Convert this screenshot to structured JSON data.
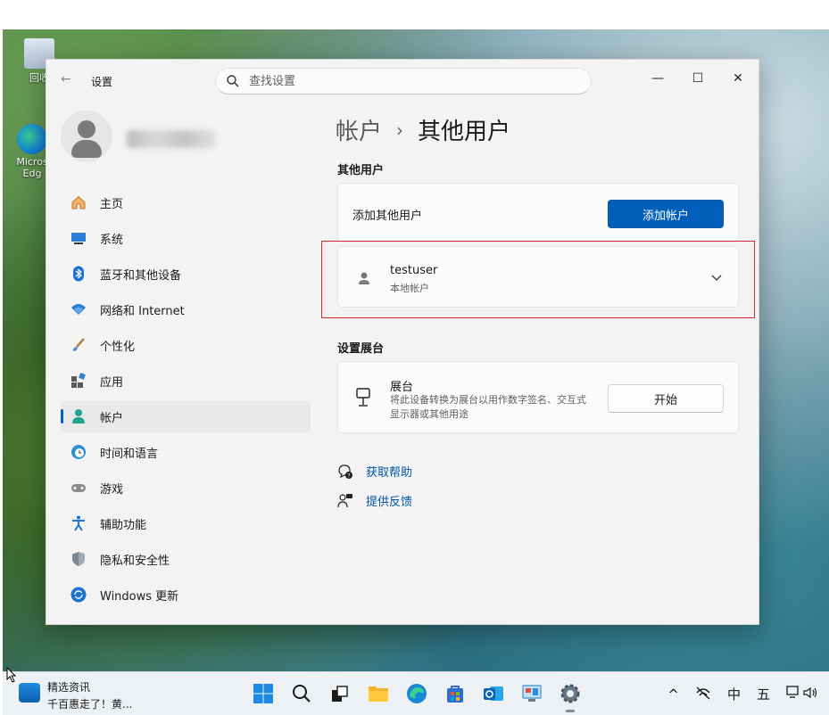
{
  "desktop": {
    "icons": [
      {
        "label": "回收"
      },
      {
        "label": "Micros Edg"
      }
    ]
  },
  "window": {
    "title": "设置",
    "search_placeholder": "查找设置",
    "controls": {
      "minimize": "—",
      "maximize": "☐",
      "close": "✕"
    }
  },
  "sidebar": {
    "items": [
      {
        "label": "主页",
        "icon": "home-icon"
      },
      {
        "label": "系统",
        "icon": "monitor-icon"
      },
      {
        "label": "蓝牙和其他设备",
        "icon": "bluetooth-icon"
      },
      {
        "label": "网络和 Internet",
        "icon": "wifi-icon"
      },
      {
        "label": "个性化",
        "icon": "brush-icon"
      },
      {
        "label": "应用",
        "icon": "apps-icon"
      },
      {
        "label": "帐户",
        "icon": "account-icon",
        "active": true
      },
      {
        "label": "时间和语言",
        "icon": "globe-clock-icon"
      },
      {
        "label": "游戏",
        "icon": "gamepad-icon"
      },
      {
        "label": "辅助功能",
        "icon": "accessibility-icon"
      },
      {
        "label": "隐私和安全性",
        "icon": "shield-icon"
      },
      {
        "label": "Windows 更新",
        "icon": "update-icon"
      }
    ]
  },
  "main": {
    "breadcrumb": {
      "parent": "帐户",
      "separator": "›",
      "current": "其他用户"
    },
    "other_users": {
      "section_title": "其他用户",
      "add_label": "添加其他用户",
      "add_button": "添加帐户",
      "user": {
        "name": "testuser",
        "type": "本地帐户"
      }
    },
    "kiosk": {
      "section_title": "设置展台",
      "title": "展台",
      "description": "将此设备转换为展台以用作数字签名、交互式显示器或其他用途",
      "button": "开始"
    },
    "links": {
      "help": "获取帮助",
      "feedback": "提供反馈"
    }
  },
  "taskbar": {
    "news_title": "精选资讯",
    "news_sub": "千百惠走了！黄...",
    "tray": {
      "chevron": "^",
      "lang1": "中",
      "lang2": "五"
    }
  },
  "colors": {
    "accent": "#005fb8",
    "highlight": "#d9262c",
    "link": "#0054a6"
  }
}
